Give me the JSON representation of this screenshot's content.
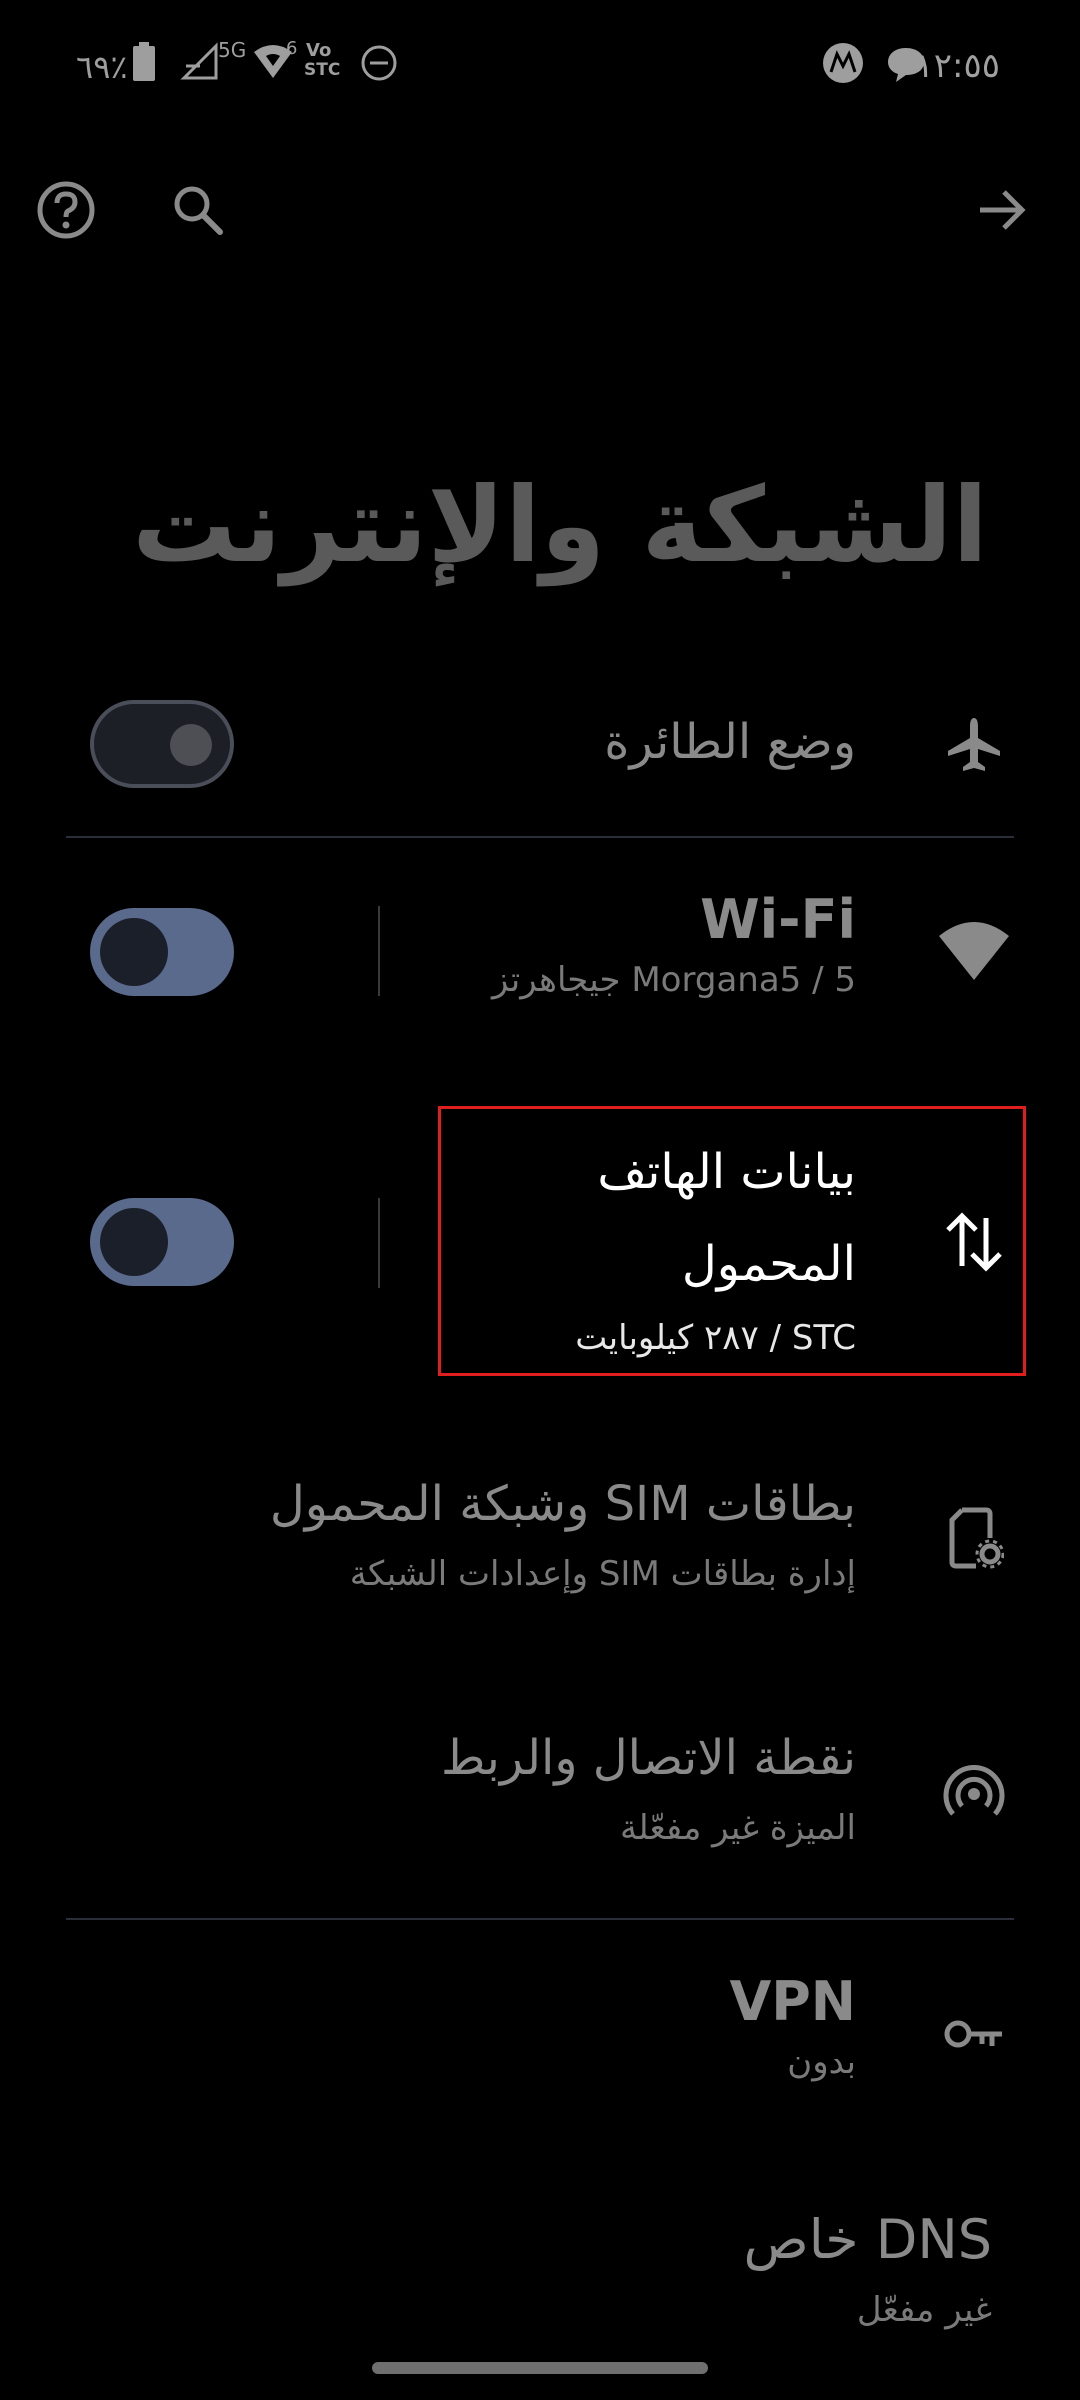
{
  "status_bar": {
    "time": "١٢:٥٥",
    "battery": "٦٩٪",
    "network_5g": "5G",
    "volte": "Vo",
    "volte_carrier": "STC",
    "wifi_gen": "6",
    "icons": [
      "battery-icon",
      "signal-icon",
      "wifi6-icon",
      "volte-icon",
      "dnd-icon",
      "motorola-icon",
      "message-icon"
    ]
  },
  "toolbar": {
    "help_icon": "help-icon",
    "search_icon": "search-icon",
    "back_icon": "arrow-forward-icon"
  },
  "page": {
    "title": "الشبكة والإنترنت"
  },
  "settings": {
    "airplane": {
      "title": "وضع الطائرة",
      "icon": "airplane-icon",
      "enabled": false
    },
    "wifi": {
      "title": "Wi-Fi",
      "subtitle": "Morgana5 / 5 جيجاهرتز",
      "icon": "wifi-icon",
      "enabled": true
    },
    "mobile_data": {
      "title_line1": "بيانات الهاتف",
      "title_line2": "المحمول",
      "subtitle": "STC / ٢٨٧ كيلوبايت",
      "icon": "data-arrows-icon",
      "enabled": true
    },
    "sim": {
      "title": "بطاقات SIM وشبكة المحمول",
      "subtitle": "إدارة بطاقات SIM وإعدادات الشبكة",
      "icon": "sim-settings-icon"
    },
    "hotspot": {
      "title": "نقطة الاتصال والربط",
      "subtitle": "الميزة غير مفعّلة",
      "icon": "hotspot-icon"
    },
    "vpn": {
      "title": "VPN",
      "subtitle": "بدون",
      "icon": "key-icon"
    },
    "dns": {
      "title": "DNS خاص",
      "subtitle": "غير مفعّل"
    }
  },
  "colors": {
    "background": "#000000",
    "toggle_on": "#5a6a8c",
    "highlight": "#e01e1e"
  }
}
